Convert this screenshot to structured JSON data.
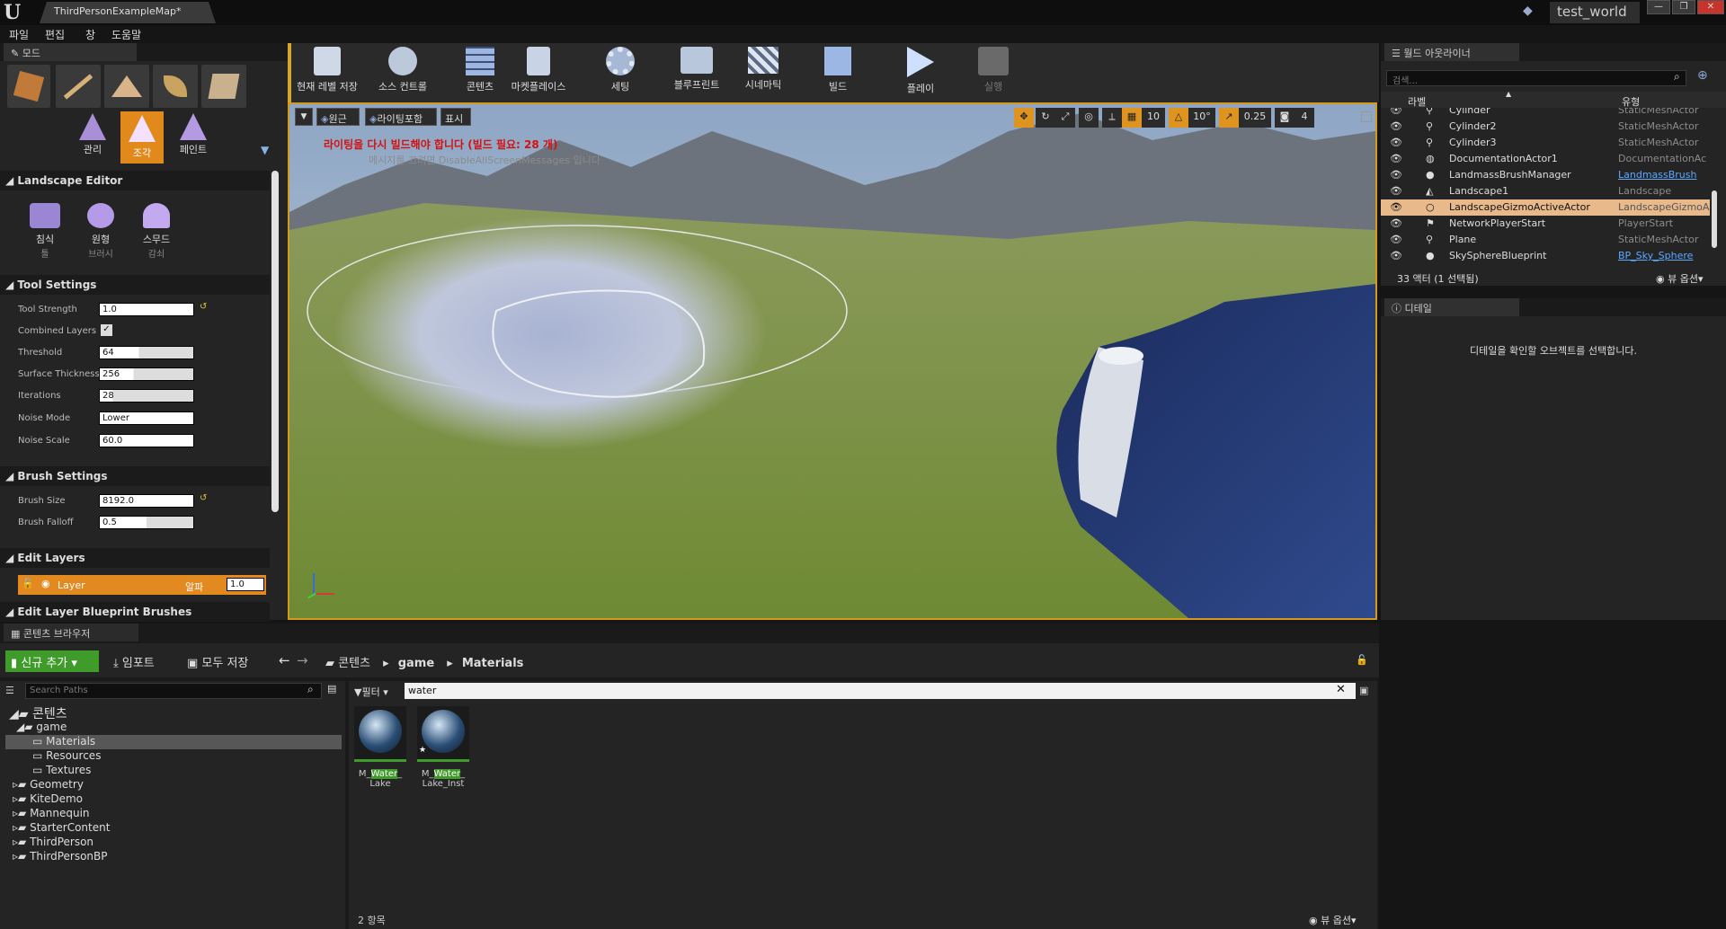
{
  "window": {
    "doc_tab": "ThirdPersonExampleMap*",
    "project": "test_world"
  },
  "menu": [
    "파일",
    "편집",
    "창",
    "도움말"
  ],
  "modes_panel": {
    "tab": "모드",
    "mode_labels": [
      "관리",
      "조각",
      "페인트"
    ],
    "landscape_editor": "Landscape Editor",
    "tools": [
      {
        "label": "침식",
        "sub": "툴"
      },
      {
        "label": "원형",
        "sub": "브러시"
      },
      {
        "label": "스무드",
        "sub": "감쇠"
      }
    ],
    "tool_settings": {
      "title": "Tool Settings",
      "rows": [
        {
          "label": "Tool Strength",
          "value": "1.0"
        },
        {
          "label": "Combined Layers",
          "value": ""
        },
        {
          "label": "Threshold",
          "value": "64"
        },
        {
          "label": "Surface Thickness",
          "value": "256"
        },
        {
          "label": "Iterations",
          "value": "28"
        },
        {
          "label": "Noise Mode",
          "value": "Lower"
        },
        {
          "label": "Noise Scale",
          "value": "60.0"
        }
      ]
    },
    "brush_settings": {
      "title": "Brush Settings",
      "rows": [
        {
          "label": "Brush Size",
          "value": "8192.0"
        },
        {
          "label": "Brush Falloff",
          "value": "0.5"
        }
      ]
    },
    "edit_layers": {
      "title": "Edit Layers",
      "layer": "Layer",
      "alpha_label": "알파",
      "alpha": "1.0"
    },
    "edit_layer_bp": "Edit Layer Blueprint Brushes"
  },
  "toolbar": [
    {
      "label": "현재 레벨 저장",
      "icon": "save-icon"
    },
    {
      "label": "소스 컨트롤",
      "icon": "source-control-icon"
    },
    {
      "label": "콘텐츠",
      "icon": "content-icon"
    },
    {
      "label": "마켓플레이스",
      "icon": "marketplace-icon"
    },
    {
      "label": "세팅",
      "icon": "settings-icon"
    },
    {
      "label": "블루프린트",
      "icon": "blueprint-icon"
    },
    {
      "label": "시네마틱",
      "icon": "cinematic-icon"
    },
    {
      "label": "빌드",
      "icon": "build-icon"
    },
    {
      "label": "플레이",
      "icon": "play-icon"
    },
    {
      "label": "실행",
      "icon": "launch-icon"
    }
  ],
  "viewport": {
    "perspective": "원근",
    "lighting": "라이팅포함",
    "show": "표시",
    "warning": "라이팅을 다시 빌드해야 합니다 (빌드 필요: 28 개)",
    "warning_sub": "메시지를 끄려면 DisableAllScreenMessages 입니다",
    "grid_snap": "10",
    "rot_snap": "10°",
    "scale_snap": "0.25",
    "cam_speed": "4"
  },
  "outliner": {
    "tab": "월드 아웃라이너",
    "search_placeholder": "검색...",
    "col_label": "라벨",
    "col_type": "유형",
    "rows": [
      {
        "name": "Cylinder",
        "type": "StaticMeshActor"
      },
      {
        "name": "Cylinder2",
        "type": "StaticMeshActor"
      },
      {
        "name": "Cylinder3",
        "type": "StaticMeshActor"
      },
      {
        "name": "DocumentationActor1",
        "type": "DocumentationAc"
      },
      {
        "name": "LandmassBrushManager",
        "type": "LandmassBrush"
      },
      {
        "name": "Landscape1",
        "type": "Landscape"
      },
      {
        "name": "LandscapeGizmoActiveActor",
        "type": "LandscapeGizmoA"
      },
      {
        "name": "NetworkPlayerStart",
        "type": "PlayerStart"
      },
      {
        "name": "Plane",
        "type": "StaticMeshActor"
      },
      {
        "name": "SkySphereBlueprint",
        "type": "BP_Sky_Sphere"
      }
    ],
    "count": "33 액터 (1 선택됨)",
    "view_options": "뷰 옵션"
  },
  "details": {
    "tab": "디테일",
    "empty": "디테일을 확인할 오브젝트를 선택합니다."
  },
  "content_browser": {
    "tab": "콘텐츠 브라우저",
    "add_new": "신규 추가",
    "import": "임포트",
    "save_all": "모두 저장",
    "path": [
      "콘텐츠",
      "game",
      "Materials"
    ],
    "search_paths": "Search Paths",
    "filter": "필터",
    "search_value": "water",
    "tree": [
      {
        "label": "콘텐츠",
        "level": 0
      },
      {
        "label": "game",
        "level": 1
      },
      {
        "label": "Materials",
        "level": 2
      },
      {
        "label": "Resources",
        "level": 2
      },
      {
        "label": "Textures",
        "level": 2
      },
      {
        "label": "Geometry",
        "level": 1
      },
      {
        "label": "KiteDemo",
        "level": 1
      },
      {
        "label": "Mannequin",
        "level": 1
      },
      {
        "label": "StarterContent",
        "level": 1
      },
      {
        "label": "ThirdPerson",
        "level": 1
      },
      {
        "label": "ThirdPersonBP",
        "level": 1
      }
    ],
    "assets": [
      {
        "pre": "M_",
        "hl": "Water",
        "post": "_",
        "line2": "Lake"
      },
      {
        "pre": "M_",
        "hl": "Water",
        "post": "_",
        "line2": "Lake_Inst"
      }
    ],
    "item_count": "2 항목",
    "view_options": "뷰 옵션"
  }
}
